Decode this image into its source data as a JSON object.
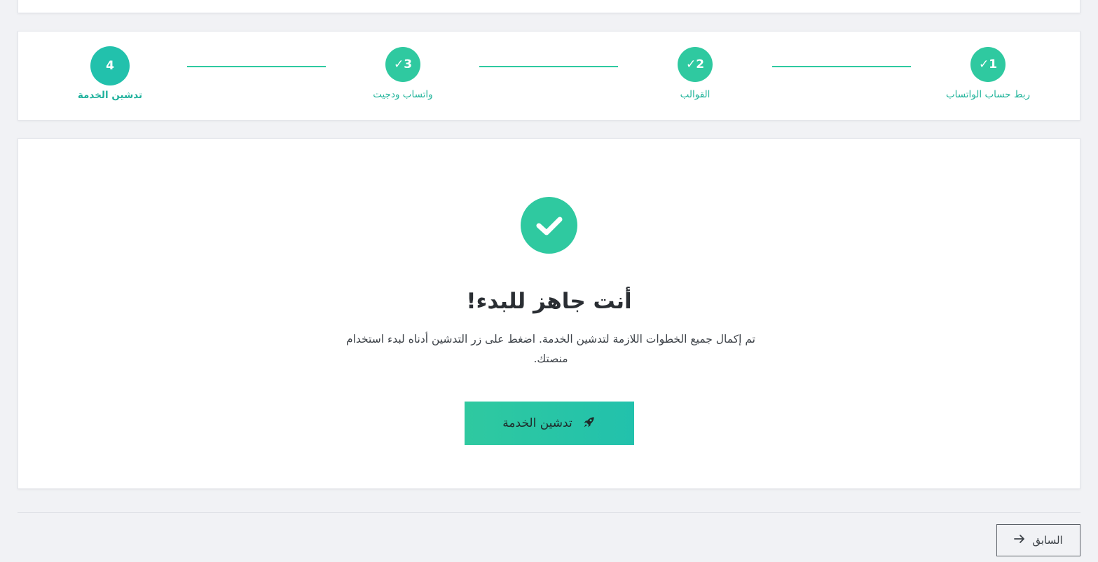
{
  "stepper": {
    "steps": [
      {
        "number": "1",
        "mark": "✓",
        "label": "ربط حساب الواتساب",
        "status": "done"
      },
      {
        "number": "2",
        "mark": "✓",
        "label": "القوالب",
        "status": "done"
      },
      {
        "number": "3",
        "mark": "✓",
        "label": "واتساب ودجيت",
        "status": "done"
      },
      {
        "number": "4",
        "mark": "",
        "label": "تدشين الخدمة",
        "status": "active"
      }
    ]
  },
  "main": {
    "success_icon": "check-icon",
    "title": "أنت جاهز للبدء!",
    "description": "تم إكمال جميع الخطوات اللازمة لتدشين الخدمة. اضغط على زر التدشين أدناه لبدء استخدام منصتك.",
    "launch_button": {
      "label": "تدشين الخدمة",
      "icon": "rocket-icon"
    }
  },
  "footer": {
    "prev_button": {
      "label": "السابق",
      "icon": "arrow-right-icon"
    }
  },
  "colors": {
    "accent": "#2fc9a0",
    "accent_dark": "#22c1ac",
    "text": "#2a2e33",
    "background": "#f1f2f5"
  }
}
